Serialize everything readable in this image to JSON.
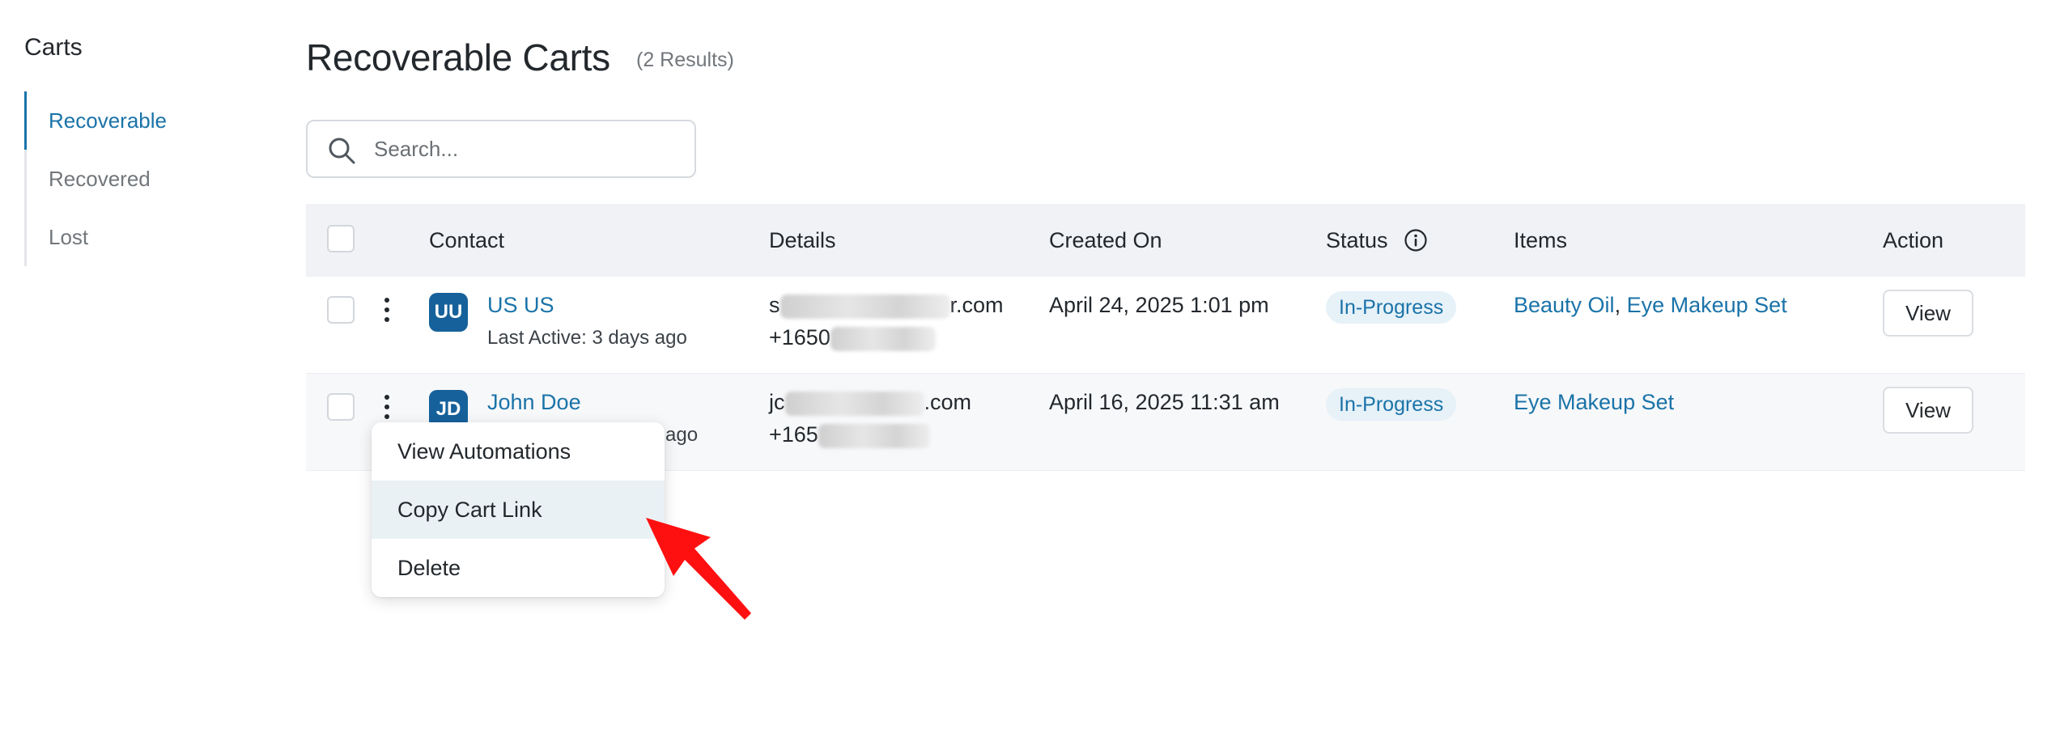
{
  "sidebar": {
    "title": "Carts",
    "items": [
      {
        "label": "Recoverable",
        "active": true
      },
      {
        "label": "Recovered",
        "active": false
      },
      {
        "label": "Lost",
        "active": false
      }
    ]
  },
  "header": {
    "title": "Recoverable Carts",
    "count": "(2 Results)"
  },
  "search": {
    "placeholder": "Search..."
  },
  "table": {
    "columns": {
      "contact": "Contact",
      "details": "Details",
      "created_on": "Created On",
      "status": "Status",
      "items": "Items",
      "action": "Action"
    },
    "rows": [
      {
        "initials": "UU",
        "name": "US US",
        "last_active": "Last Active: 3 days ago",
        "email_prefix": "s",
        "email_suffix": "r.com",
        "phone_prefix": "+1650",
        "created_on": "April 24, 2025 1:01 pm",
        "status": "In-Progress",
        "items": [
          "Beauty Oil",
          "Eye Makeup Set"
        ],
        "item_separator": ",",
        "action": "View"
      },
      {
        "initials": "JD",
        "name": "John Doe",
        "last_active": "ago",
        "email_prefix": "jc",
        "email_suffix": ".com",
        "phone_prefix": "+165",
        "created_on": "April 16, 2025 11:31 am",
        "status": "In-Progress",
        "items": [
          "Eye Makeup Set"
        ],
        "action": "View"
      }
    ]
  },
  "row_menu": {
    "items": [
      "View Automations",
      "Copy Cart Link",
      "Delete"
    ],
    "highlighted": "Copy Cart Link"
  },
  "icons": {
    "search": "search-icon",
    "info": "info-icon",
    "kebab": "kebab-menu-icon",
    "pointer": "red-arrow-pointer"
  },
  "colors": {
    "accent": "#1a73a8",
    "avatar": "#16619b",
    "badge_bg": "#e6f1f8",
    "header_bg": "#f0f2f6",
    "arrow": "#ff0000"
  }
}
